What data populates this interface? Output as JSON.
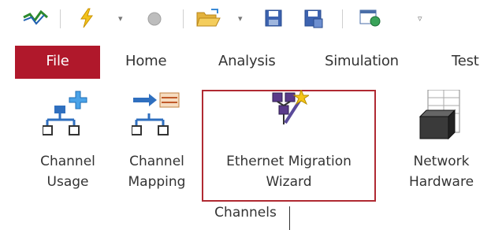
{
  "quick_access": {
    "items": [
      {
        "icon": "signal-wave-icon"
      },
      {
        "icon": "lightning-icon"
      },
      {
        "icon": "stop-circle-icon"
      },
      {
        "icon": "open-folder-icon"
      },
      {
        "icon": "save-disk-icon"
      },
      {
        "icon": "save-as-disk-icon"
      },
      {
        "icon": "window-globe-icon"
      }
    ],
    "dropdown_glyph": "▾",
    "customize_glyph": "▿"
  },
  "ribbon": {
    "tabs": [
      {
        "label": "File",
        "active": true
      },
      {
        "label": "Home"
      },
      {
        "label": "Analysis"
      },
      {
        "label": "Simulation"
      },
      {
        "label": "Test"
      }
    ],
    "group": {
      "label": "Channels",
      "buttons": [
        {
          "line1": "Channel",
          "line2": "Usage",
          "icon": "channel-usage-icon"
        },
        {
          "line1": "Channel",
          "line2": "Mapping",
          "icon": "channel-mapping-icon"
        },
        {
          "line1": "Ethernet Migration",
          "line2": "Wizard",
          "icon": "migration-wizard-icon",
          "highlighted": true
        },
        {
          "line1": "Network",
          "line2": "Hardware",
          "icon": "network-hardware-icon"
        }
      ]
    }
  },
  "colors": {
    "file_tab": "#b0182b",
    "highlight_border": "#b02a32",
    "icon_blue": "#2f6fbf",
    "icon_purple": "#5a3a8a"
  }
}
